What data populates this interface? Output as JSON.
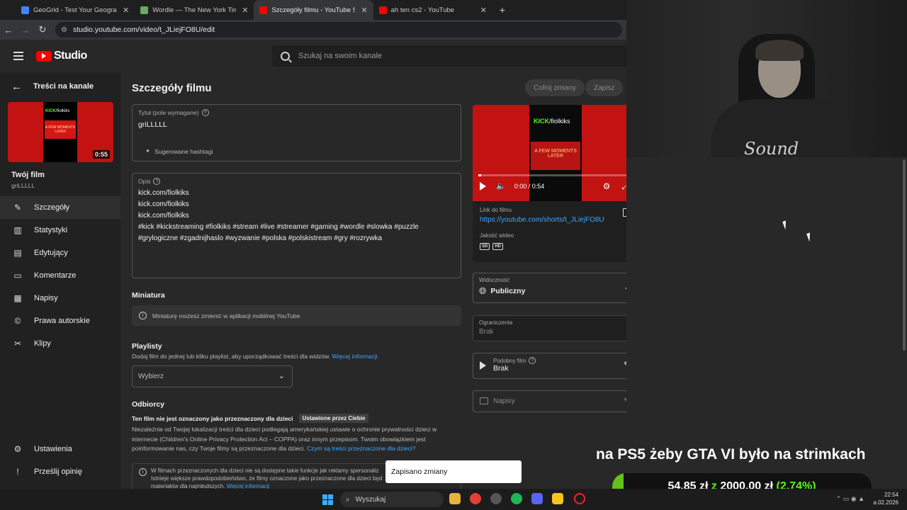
{
  "browser": {
    "tabs": [
      {
        "title": "GeoGrid - Test Your Geography",
        "color": "#4285f4"
      },
      {
        "title": "Wordle — The New York Times",
        "color": "#6aaa64"
      },
      {
        "title": "Szczegóły filmu - YouTube Studio",
        "color": "#ff0000"
      },
      {
        "title": "ah ten cs2 - YouTube",
        "color": "#ff0000"
      }
    ],
    "url": "studio.youtube.com/video/t_JLiejFO8U/edit"
  },
  "header": {
    "logo_text": "Studio",
    "search_placeholder": "Szukaj na swoim kanale"
  },
  "sidebar": {
    "back_label": "Treści na kanale",
    "thumb_duration": "0:55",
    "thumb_brand": "KICK",
    "thumb_brand_suffix": "/fiolkiks",
    "thumb_caption": "A FEW MOMENTS LATER",
    "your_film": "Twój film",
    "film_title": "griLLLLL",
    "items": [
      {
        "label": "Szczegóły",
        "icon": "✎"
      },
      {
        "label": "Statystyki",
        "icon": "▥"
      },
      {
        "label": "Edytujący",
        "icon": "▤"
      },
      {
        "label": "Komentarze",
        "icon": "▭"
      },
      {
        "label": "Napisy",
        "icon": "▦"
      },
      {
        "label": "Prawa autorskie",
        "icon": "©"
      },
      {
        "label": "Klipy",
        "icon": "✂"
      }
    ],
    "bottom_items": [
      {
        "label": "Ustawienia",
        "icon": "⚙"
      },
      {
        "label": "Prześlij opinię",
        "icon": "!"
      }
    ]
  },
  "main": {
    "title": "Szczegóły filmu",
    "undo_label": "Cofnij zmiany",
    "save_label": "Zapisz",
    "title_field": {
      "label": "Tytuł (pole wymagane)",
      "value": "griLLLLL",
      "hashtags": "Sugerowane hashtagi"
    },
    "description": {
      "label": "Opis",
      "lines": [
        "kick.com/fiolkiks",
        "kick.com/fiolkiks",
        "kick.com/fiolkiks",
        "#kick #kickstreaming #fiolkiks #stream #live #streamer #gaming #wordle #slowka #puzzle",
        "#grylogiczne #zgadnijhaslo #wyzwanie #polska #polskistream #gry #rozrywka"
      ]
    },
    "thumbnail": {
      "title": "Miniatura",
      "info": "Miniaturę możesz zmienić w aplikacji mobilnej YouTube"
    },
    "playlists": {
      "title": "Playlisty",
      "desc": "Dodaj film do jednej lub kilku playlist, aby uporządkować treści dla widzów.",
      "more": "Więcej informacji",
      "select": "Wybierz"
    },
    "audience": {
      "title": "Odbiorcy",
      "status": "Ten film nie jest oznaczony jako przeznaczony dla dzieci",
      "badge": "Ustawione przez Ciebie",
      "text1": "Niezależnie od Twojej lokalizacji treści dla dzieci podlegają amerykańskiej ustawie o ochronie prywatności dzieci w",
      "text2": "internecie (Children's Online Privacy Protection Act – COPPA) oraz innym przepisom. Twoim obowiązkiem jest",
      "text3": "poinformowanie nas, czy Twoje filmy są przeznaczone dla dzieci.",
      "text3_link": "Czym są treści przeznaczone dla dzieci?",
      "note1": "W filmach przeznaczonych dla dzieci nie są dostępne takie funkcje jak reklamy spersonaliz",
      "note2": "Istnieje większe prawdopodobieństwo, że filmy oznaczone jako przeznaczone dla dzieci będ",
      "note3": "materiałów dla najmłodszych.",
      "note3_link": "Więcej informacji"
    }
  },
  "video_card": {
    "time": "0:00 / 0:54",
    "progress": 0.02,
    "link_label": "Link do filmu",
    "link": "https://youtube.com/shorts/t_JLiejFO8U",
    "quality_label": "Jakość wideo",
    "quality_sd": "SD",
    "quality_hd": "HD"
  },
  "right_fields": {
    "visibility_label": "Widoczność",
    "visibility_value": "Publiczny",
    "restrictions_label": "Ograniczenia",
    "restrictions_value": "Brak",
    "related_label": "Podobny film",
    "related_value": "Brak",
    "subtitles_placeholder": "Napisy"
  },
  "toast": "Zapisano zmiany",
  "overlay": {
    "stream_text": "na PS5 żeby GTA VI było na strimkach",
    "goal_current": "54,85 zł",
    "goal_sep": "z",
    "goal_target": "2000,00 zł",
    "goal_percent": "(2.74%)"
  },
  "taskbar": {
    "search": "Wyszukaj",
    "time": "22:54",
    "date": "a.02.2026"
  }
}
